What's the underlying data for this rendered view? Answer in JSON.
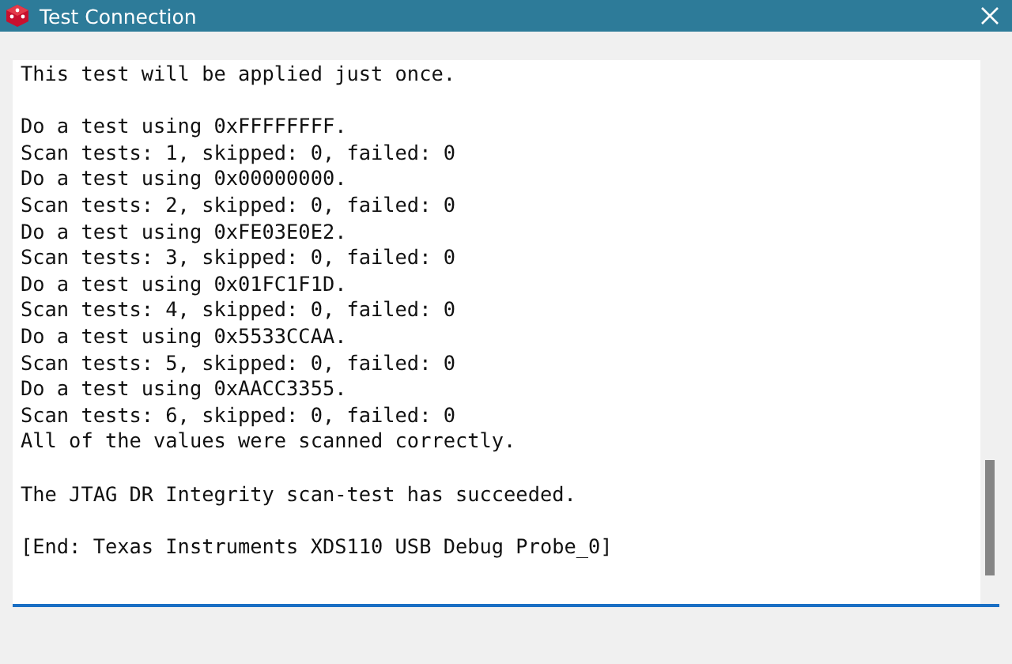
{
  "window": {
    "title": "Test Connection"
  },
  "output": {
    "blocks": [
      [
        "This test will be applied just once."
      ],
      [
        "Do a test using 0xFFFFFFFF.",
        "Scan tests: 1, skipped: 0, failed: 0",
        "Do a test using 0x00000000.",
        "Scan tests: 2, skipped: 0, failed: 0",
        "Do a test using 0xFE03E0E2.",
        "Scan tests: 3, skipped: 0, failed: 0",
        "Do a test using 0x01FC1F1D.",
        "Scan tests: 4, skipped: 0, failed: 0",
        "Do a test using 0x5533CCAA.",
        "Scan tests: 5, skipped: 0, failed: 0",
        "Do a test using 0xAACC3355.",
        "Scan tests: 6, skipped: 0, failed: 0",
        "All of the values were scanned correctly."
      ],
      [
        "The JTAG DR Integrity scan-test has succeeded."
      ],
      [
        "[End: Texas Instruments XDS110 USB Debug Probe_0]"
      ]
    ]
  }
}
